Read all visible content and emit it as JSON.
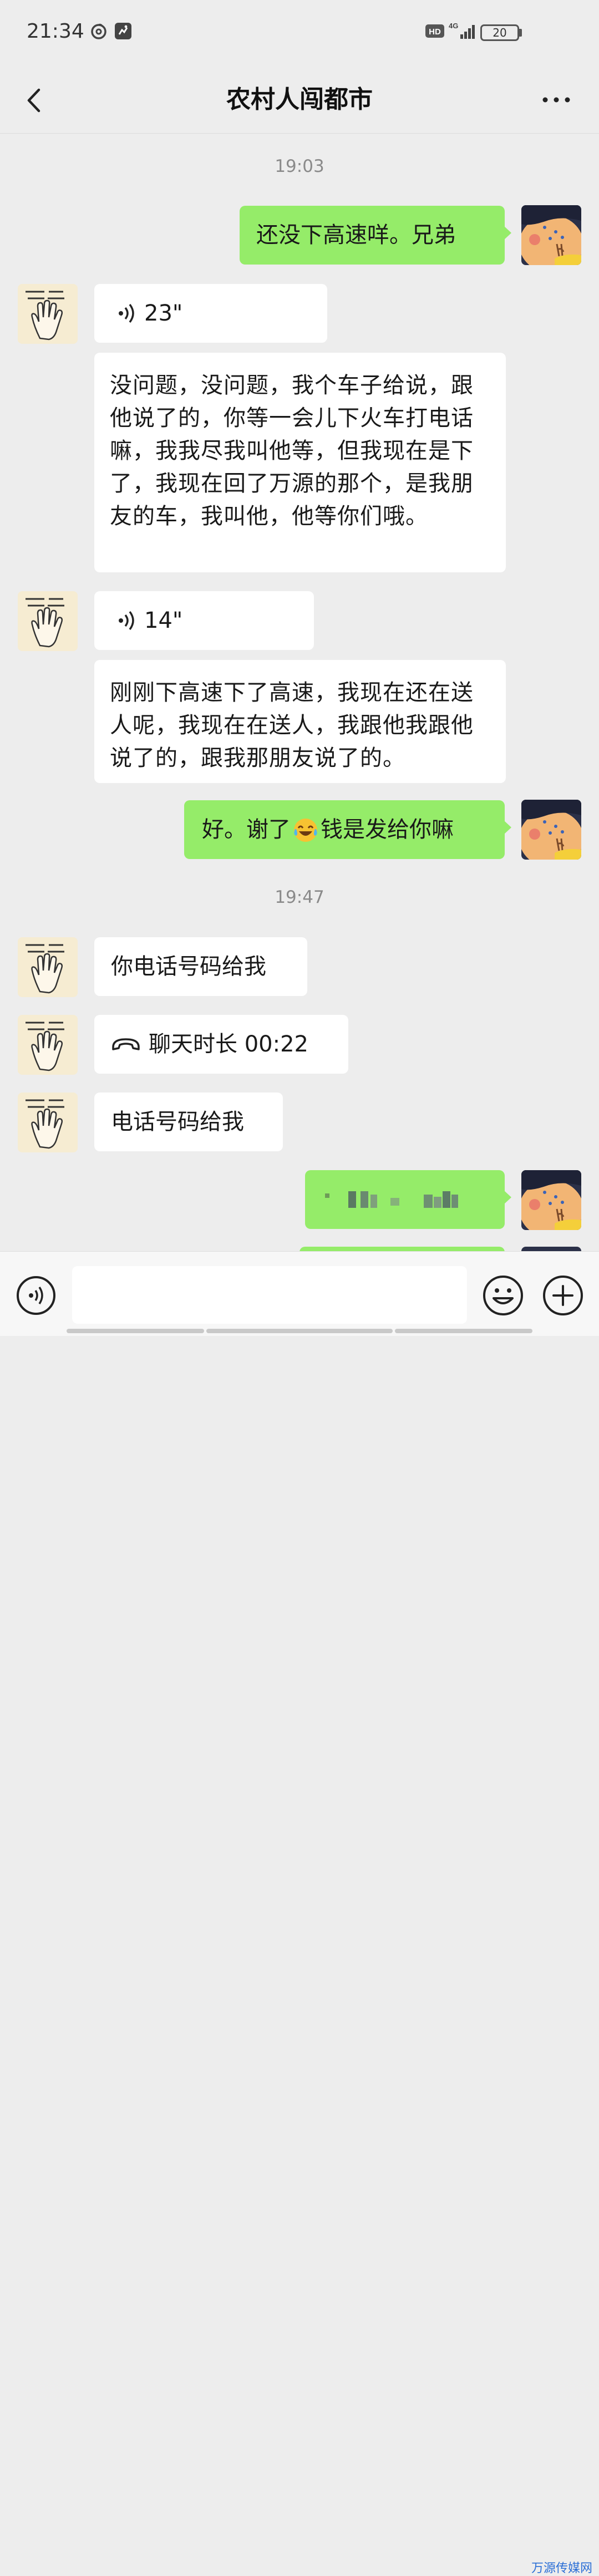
{
  "status_bar": {
    "time": "21:34",
    "network": "4G",
    "battery": "20"
  },
  "header": {
    "title": "农村人闯都市"
  },
  "timestamps": [
    "19:03",
    "19:47"
  ],
  "messages": [
    {
      "from": "me",
      "type": "text",
      "text": "还没下高速咩。兄弟"
    },
    {
      "from": "friend",
      "type": "voice",
      "duration": "23\""
    },
    {
      "from": "friend",
      "type": "transcript",
      "text": "没问题，没问题，我个车子给说，跟他说了的，你等一会儿下火车打电话嘛，我我尽我叫他等，但我现在是下了，我现在回了万源的那个，是我朋友的车，我叫他，他等你们哦。"
    },
    {
      "from": "friend",
      "type": "voice",
      "duration": "14\""
    },
    {
      "from": "friend",
      "type": "transcript",
      "text": "刚刚下高速下了高速，我现在还在送人呢，我现在在送人，我跟他我跟他说了的，跟我那朋友说了的。"
    },
    {
      "from": "me",
      "type": "text",
      "text_before": "好。谢了",
      "text_after": "钱是发给你嘛"
    },
    {
      "from": "friend",
      "type": "text",
      "text": "你电话号码给我"
    },
    {
      "from": "friend",
      "type": "call",
      "text": "聊天时长 00:22"
    },
    {
      "from": "friend",
      "type": "text",
      "text": "电话号码给我"
    },
    {
      "from": "me",
      "type": "blurred"
    }
  ],
  "watermark": "万源传媒网",
  "colors": {
    "background": "#ededed",
    "sent_bubble": "#95ec69",
    "received_bubble": "#ffffff",
    "timestamp_text": "#8a8a8a"
  },
  "icons": {
    "back": "chevron-left-icon",
    "more": "more-dots-icon",
    "voice_input": "voice-icon",
    "emoji": "emoji-icon",
    "plus": "plus-icon"
  }
}
